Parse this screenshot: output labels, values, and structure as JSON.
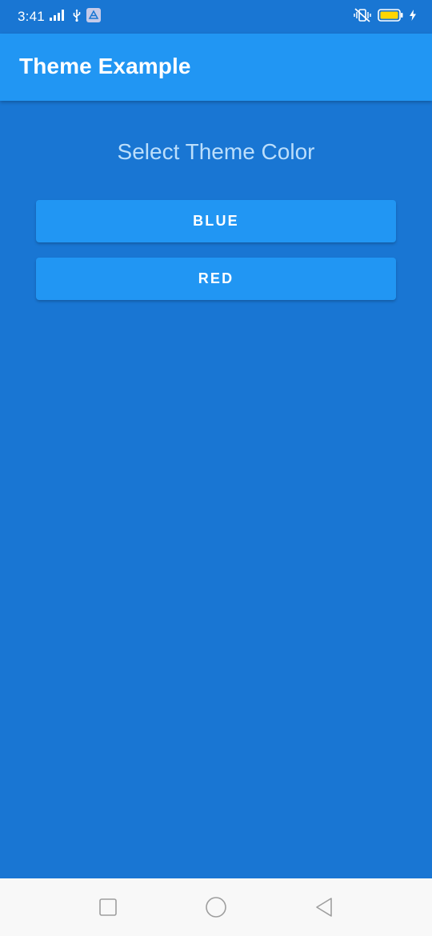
{
  "status_bar": {
    "time": "3:41",
    "icons": [
      "signal-icon",
      "usb-icon",
      "notification-app-icon",
      "vibrate-icon",
      "battery-icon",
      "charging-icon"
    ],
    "battery_color": "#FFD600"
  },
  "app_bar": {
    "title": "Theme Example",
    "color": "#2196F3"
  },
  "main": {
    "heading": "Select Theme Color",
    "background_color": "#1976D3",
    "buttons": [
      {
        "label": "BLUE"
      },
      {
        "label": "RED"
      }
    ]
  },
  "nav_bar": {
    "items": [
      "recents-square-icon",
      "home-circle-icon",
      "back-triangle-icon"
    ]
  }
}
